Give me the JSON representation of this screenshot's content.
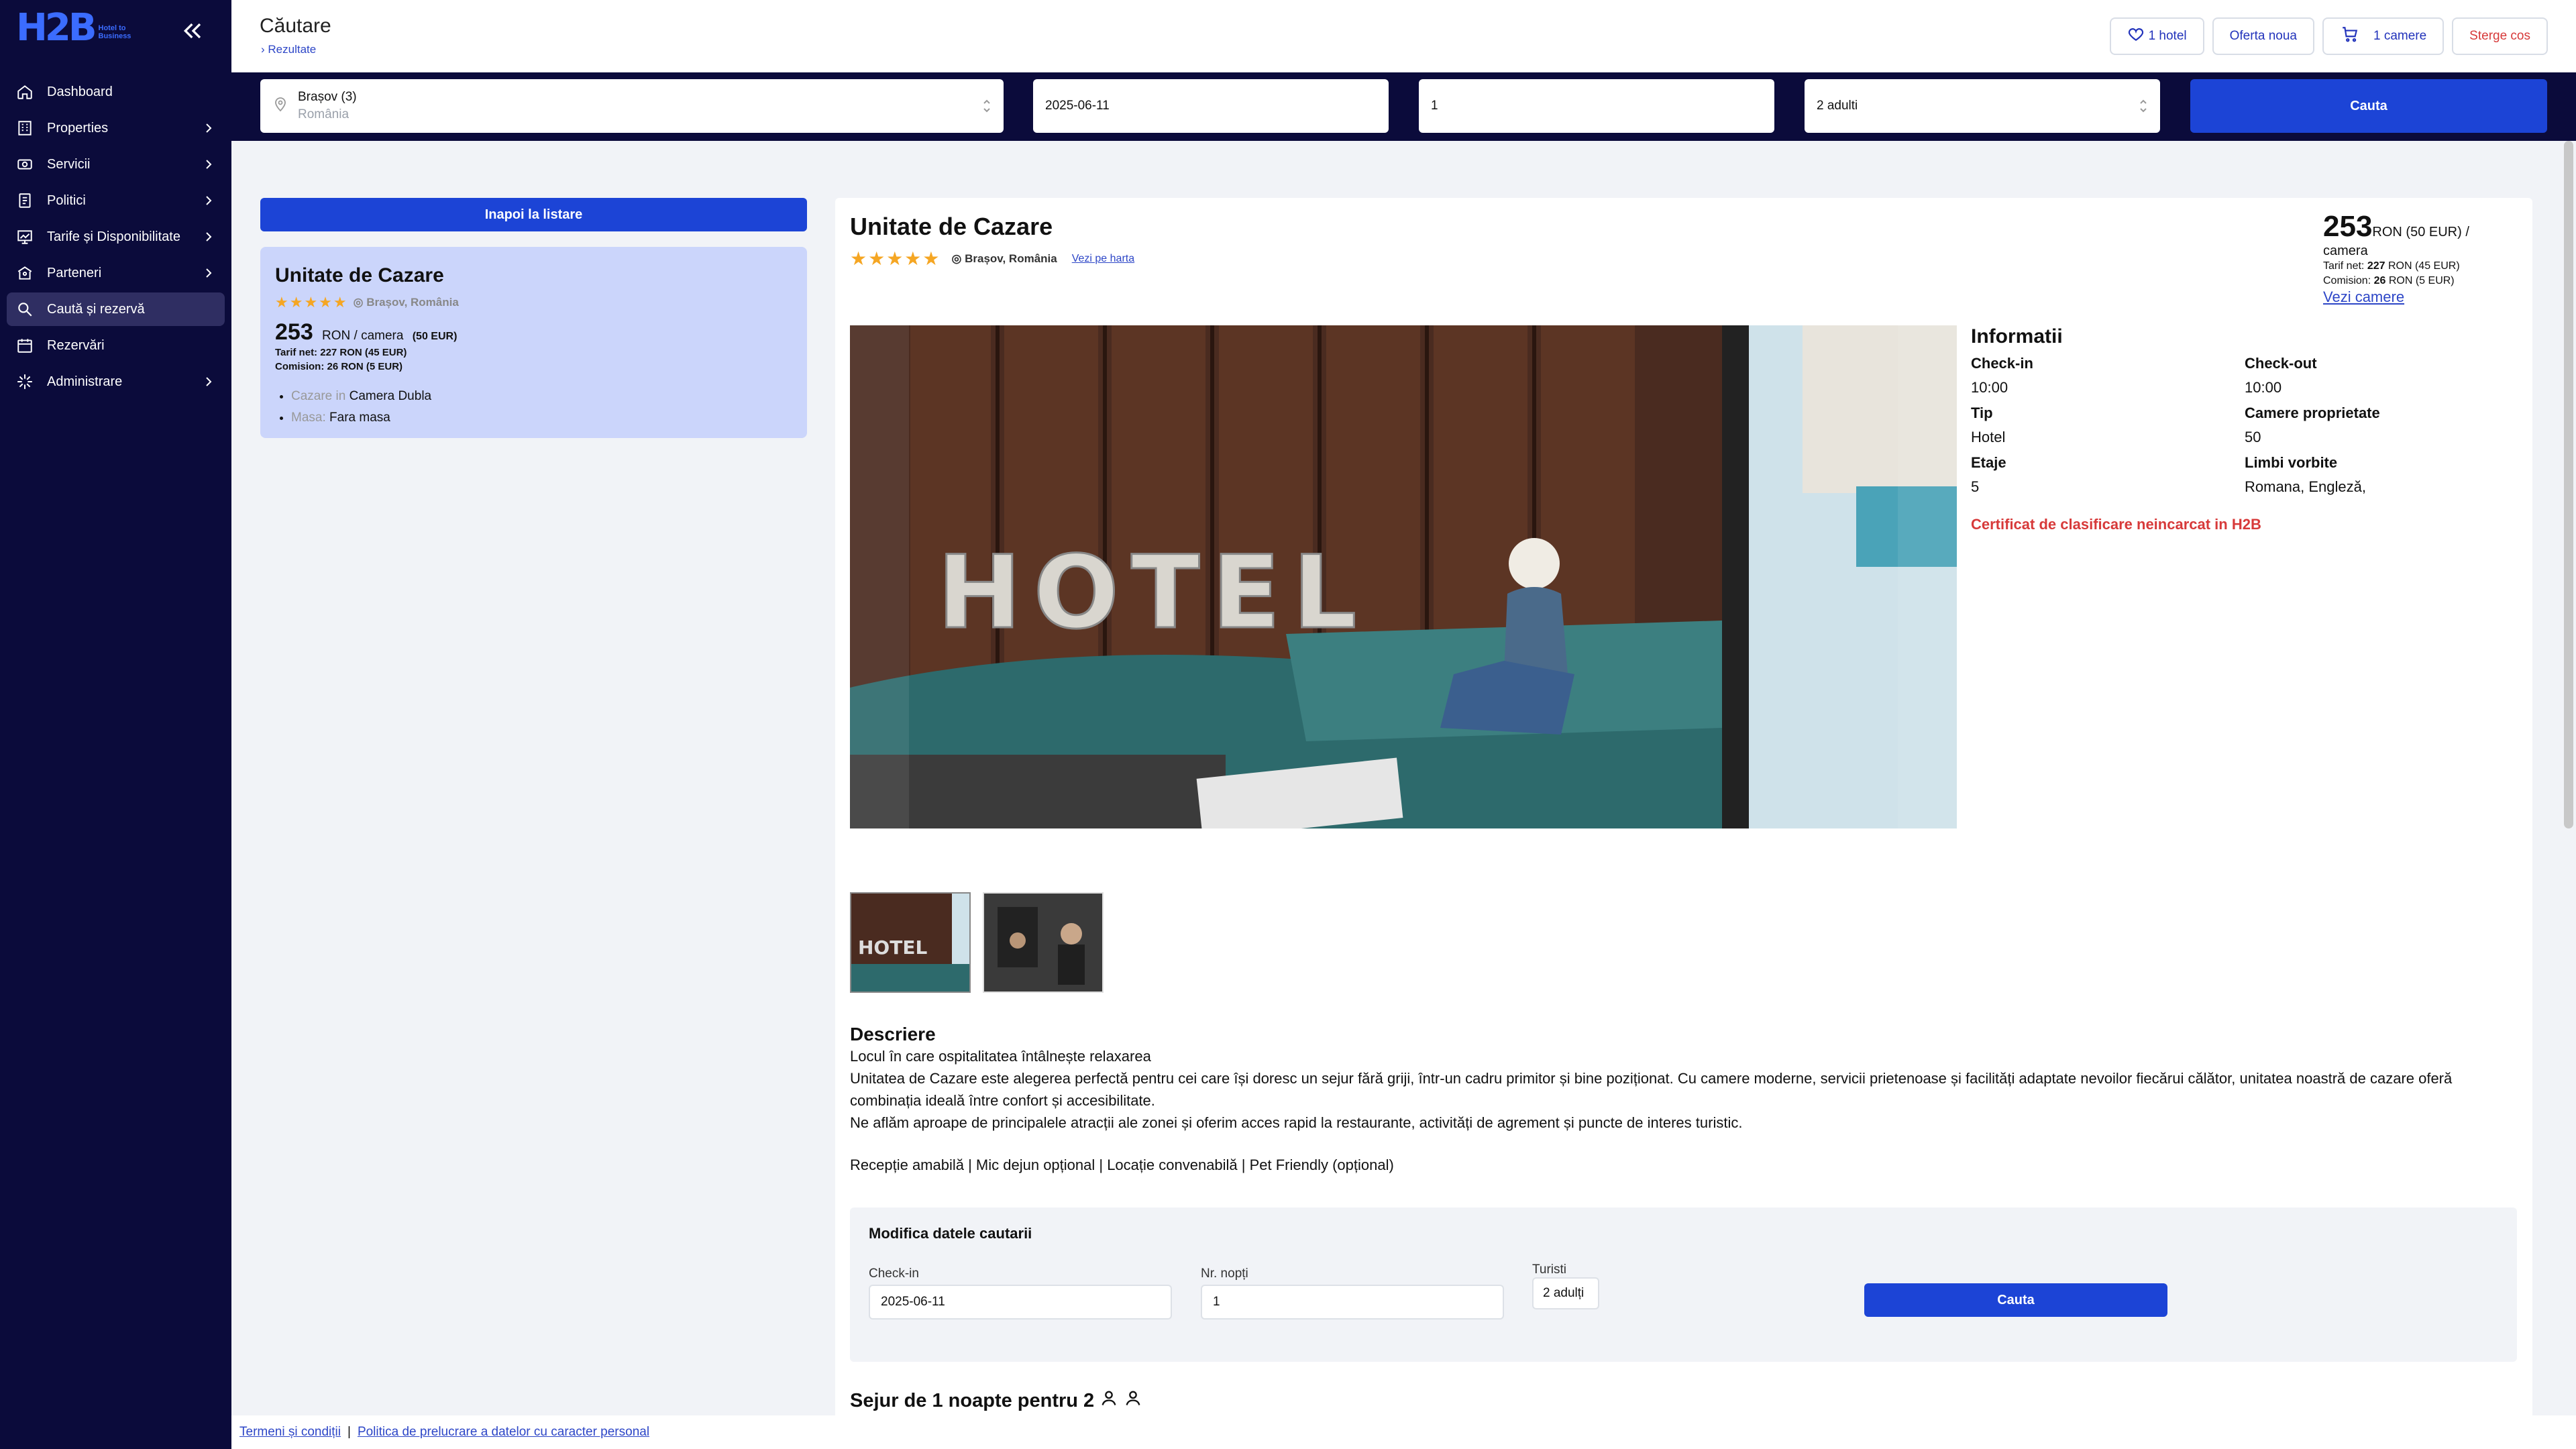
{
  "brand": {
    "logo": "H2B",
    "tagline": "Hotel to Business"
  },
  "sidebar": {
    "items": [
      {
        "label": "Dashboard",
        "icon": "home-icon",
        "chevron": false
      },
      {
        "label": "Properties",
        "icon": "building-icon",
        "chevron": true
      },
      {
        "label": "Servicii",
        "icon": "services-icon",
        "chevron": true
      },
      {
        "label": "Politici",
        "icon": "document-icon",
        "chevron": true
      },
      {
        "label": "Tarife și Disponibilitate",
        "icon": "chart-icon",
        "chevron": true
      },
      {
        "label": "Parteneri",
        "icon": "partners-icon",
        "chevron": true
      },
      {
        "label": "Caută și rezervă",
        "icon": "search-icon",
        "chevron": false,
        "active": true
      },
      {
        "label": "Rezervări",
        "icon": "calendar-icon",
        "chevron": false
      },
      {
        "label": "Administrare",
        "icon": "admin-icon",
        "chevron": true
      }
    ]
  },
  "header": {
    "title": "Căutare",
    "breadcrumb": "Rezultate",
    "actions": {
      "hotel": "1 hotel",
      "offer": "Oferta noua",
      "rooms": "1 camere",
      "clear": "Sterge cos"
    }
  },
  "search": {
    "location": "Brașov (3)",
    "country": "România",
    "date": "2025-06-11",
    "nights": "1",
    "guests": "2 adulti",
    "button": "Cauta"
  },
  "summary": {
    "back": "Inapoi la listare",
    "name": "Unitate de Cazare",
    "stars": "★★★★★",
    "location": "Brașov, România",
    "price": "253",
    "price_unit": "RON / camera",
    "price_eur": "(50 EUR)",
    "net": "Tarif net: 227 RON (45 EUR)",
    "commission": "Comision: 26 RON (5 EUR)",
    "stay_label": "Cazare in",
    "stay_value": "Camera Dubla",
    "meal_label": "Masa:",
    "meal_value": "Fara masa"
  },
  "hotel": {
    "name": "Unitate de Cazare",
    "stars": "★★★★★",
    "location": "Brașov, România",
    "map_link": "Vezi pe harta",
    "price": "253",
    "price_unit": "RON (50 EUR)",
    "per": "/ camera",
    "net_label": "Tarif net:",
    "net_value": "227",
    "net_rest": "RON (45 EUR)",
    "com_label": "Comision:",
    "com_value": "26",
    "com_rest": "RON (5 EUR)",
    "rooms_link": "Vezi camere"
  },
  "info": {
    "title": "Informatii",
    "checkin_label": "Check-in",
    "checkin": "10:00",
    "checkout_label": "Check-out",
    "checkout": "10:00",
    "type_label": "Tip",
    "type": "Hotel",
    "rooms_label": "Camere proprietate",
    "rooms": "50",
    "floors_label": "Etaje",
    "floors": "5",
    "languages_label": "Limbi vorbite",
    "languages": "Romana, Engleză,",
    "certificate": "Certificat de clasificare neincarcat in H2B"
  },
  "description": {
    "title": "Descriere",
    "line1": "Locul în care ospitalitatea întâlnește relaxarea",
    "line2": "Unitatea de Cazare este alegerea perfectă pentru cei care își doresc un sejur fără griji, într-un cadru primitor și bine poziționat. Cu camere moderne, servicii prietenoase și facilități adaptate nevoilor fiecărui călător, unitatea noastră de cazare oferă combinația ideală între confort și accesibilitate.",
    "line3": "Ne aflăm aproape de principalele atracții ale zonei și oferim acces rapid la restaurante, activități de agrement și puncte de interes turistic.",
    "amenities": "Recepție amabilă |  Mic dejun opțional |  Locație convenabilă |  Pet Friendly (opțional)"
  },
  "modify": {
    "title": "Modifica datele cautarii",
    "checkin_label": "Check-in",
    "checkin": "2025-06-11",
    "nights_label": "Nr. nopți",
    "nights": "1",
    "tourists_label": "Turisti",
    "tourists": "2 adulți",
    "button": "Cauta"
  },
  "stay_title": "Sejur de 1 noapte pentru 2",
  "footer": {
    "terms": "Termeni și condiții",
    "privacy": "Politica de prelucrare a datelor cu caracter personal"
  },
  "colors": {
    "sidebar": "#0b0b3b",
    "primary": "#1c44d6",
    "danger": "#d73a3a",
    "summary_bg": "#cbd5fb"
  }
}
